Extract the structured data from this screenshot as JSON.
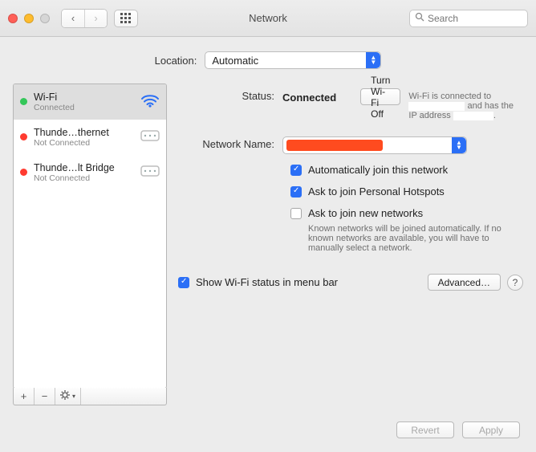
{
  "window": {
    "title": "Network"
  },
  "toolbar": {
    "search_placeholder": "Search"
  },
  "location": {
    "label": "Location:",
    "value": "Automatic"
  },
  "interfaces": [
    {
      "name": "Wi-Fi",
      "status": "Connected",
      "dot": "green",
      "icon": "wifi"
    },
    {
      "name": "Thunde…thernet",
      "status": "Not Connected",
      "dot": "red",
      "icon": "thunderbolt-net"
    },
    {
      "name": "Thunde…lt Bridge",
      "status": "Not Connected",
      "dot": "red",
      "icon": "thunderbolt-net"
    }
  ],
  "detail": {
    "status_label": "Status:",
    "status_value": "Connected",
    "turn_off_label": "Turn Wi-Fi Off",
    "status_sub_prefix": "Wi-Fi is connected to ",
    "status_sub_suffix": " and has the IP address ",
    "network_name_label": "Network Name:",
    "network_name_value": "",
    "chk_auto_join": "Automatically join this network",
    "chk_personal_hotspots": "Ask to join Personal Hotspots",
    "chk_new_networks": "Ask to join new networks",
    "new_networks_note": "Known networks will be joined automatically. If no known networks are available, you will have to manually select a network.",
    "show_menubar": "Show Wi-Fi status in menu bar",
    "advanced_label": "Advanced…"
  },
  "footer": {
    "revert": "Revert",
    "apply": "Apply"
  }
}
